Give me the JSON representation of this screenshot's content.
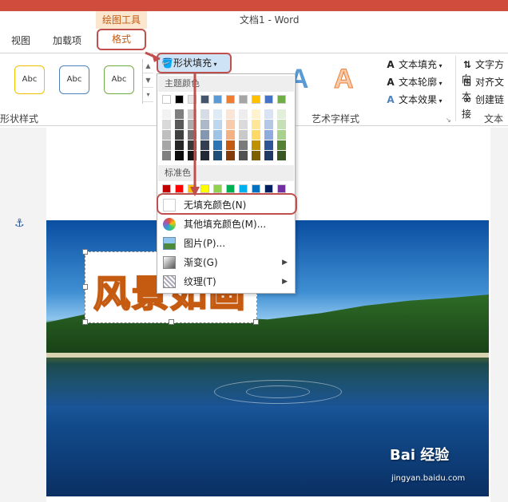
{
  "window": {
    "title": "文档1 - Word",
    "context_tab_group": "绘图工具"
  },
  "tabs": [
    {
      "label": "视图"
    },
    {
      "label": "加载项"
    },
    {
      "label": "格式"
    }
  ],
  "ribbon": {
    "shape_styles": {
      "group_label": "形状样式",
      "style_samples": [
        "Abc",
        "Abc",
        "Abc"
      ],
      "style_colors": [
        "#f2c200",
        "#4f81bd",
        "#70ad47"
      ]
    },
    "shape_fill_button": {
      "label": "形状填充"
    },
    "wordart": {
      "group_label": "艺术字样式",
      "sample_letter": "A",
      "text_fill": "文本填充",
      "text_outline": "文本轮廓",
      "text_effects": "文本效果"
    },
    "text_group": {
      "group_label": "文本",
      "text_direction": "文字方向",
      "align_text": "对齐文本",
      "create_link": "创建链接"
    }
  },
  "dropdown": {
    "theme_colors_header": "主题颜色",
    "theme_colors_top": [
      "#ffffff",
      "#000000",
      "#e7e6e6",
      "#44546a",
      "#5b9bd5",
      "#ed7d31",
      "#a5a5a5",
      "#ffc000",
      "#4472c4",
      "#70ad47"
    ],
    "theme_color_shades": [
      [
        "#f2f2f2",
        "#7f7f7f",
        "#d0cece",
        "#d6dce5",
        "#deebf7",
        "#fbe5d6",
        "#ededed",
        "#fff2cc",
        "#dae3f3",
        "#e2f0d9"
      ],
      [
        "#d9d9d9",
        "#595959",
        "#aeabab",
        "#adb9ca",
        "#bdd7ee",
        "#f8cbad",
        "#dbdbdb",
        "#ffe699",
        "#b4c7e7",
        "#c5e0b4"
      ],
      [
        "#bfbfbf",
        "#404040",
        "#757171",
        "#8497b0",
        "#9dc3e6",
        "#f4b183",
        "#c9c9c9",
        "#ffd966",
        "#8faadc",
        "#a9d18e"
      ],
      [
        "#a6a6a6",
        "#262626",
        "#3a3838",
        "#333f50",
        "#2e75b6",
        "#c55a11",
        "#7b7b7b",
        "#bf9000",
        "#2f5597",
        "#548235"
      ],
      [
        "#808080",
        "#0d0d0d",
        "#171616",
        "#222a35",
        "#1f4e79",
        "#843c0c",
        "#525252",
        "#7f6000",
        "#203864",
        "#385723"
      ]
    ],
    "standard_colors_header": "标准色",
    "standard_colors": [
      "#c00000",
      "#ff0000",
      "#ffc000",
      "#ffff00",
      "#92d050",
      "#00b050",
      "#00b0f0",
      "#0070c0",
      "#002060",
      "#7030a0"
    ],
    "items": [
      {
        "label": "无填充颜色(N)",
        "icon": "no-fill-icon",
        "submenu": false
      },
      {
        "label": "其他填充颜色(M)...",
        "icon": "color-wheel-icon",
        "submenu": false
      },
      {
        "label": "图片(P)...",
        "icon": "picture-icon",
        "submenu": false
      },
      {
        "label": "渐变(G)",
        "icon": "gradient-icon",
        "submenu": true
      },
      {
        "label": "纹理(T)",
        "icon": "texture-icon",
        "submenu": true
      }
    ]
  },
  "document": {
    "wordart_text": "风景如画",
    "accent_color": "#c55a11"
  },
  "watermark": {
    "brand": "Bai 经验",
    "url": "jingyan.baidu.com"
  }
}
